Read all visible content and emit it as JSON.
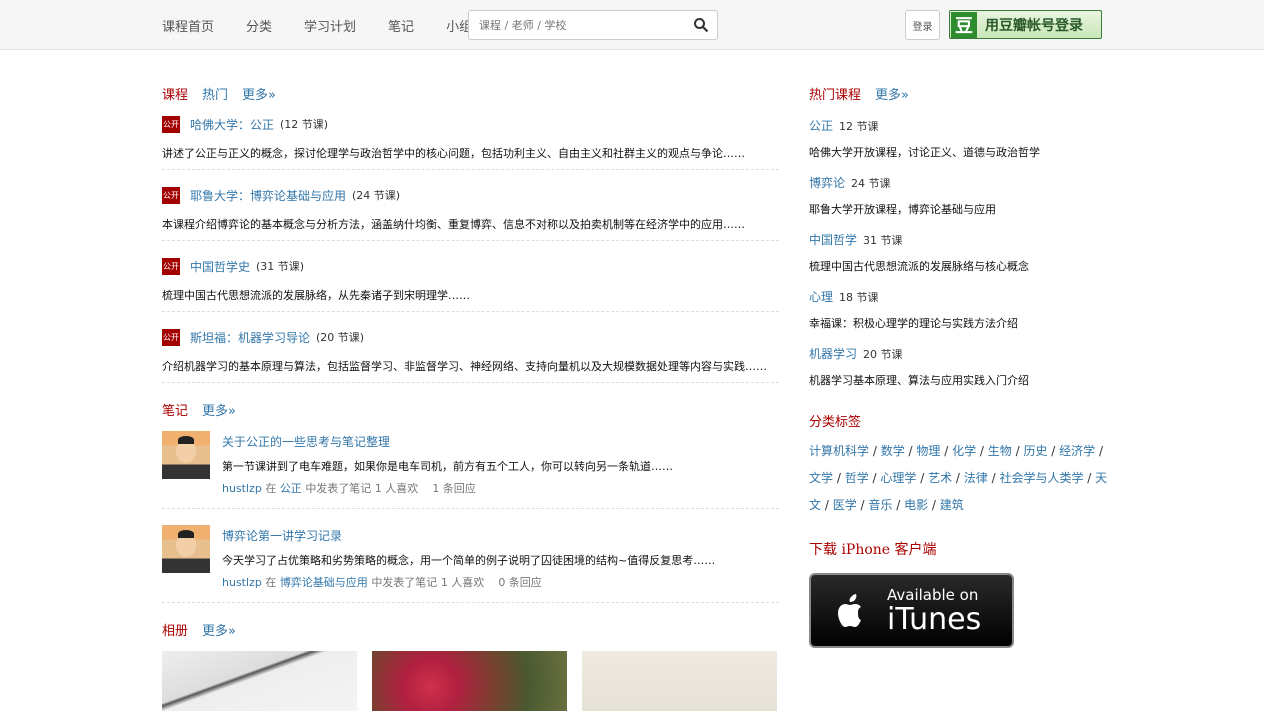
{
  "nav": [
    "课程首页",
    "分类",
    "学习计划",
    "笔记",
    "小组"
  ],
  "search": {
    "placeholder": "课程 / 老师 / 学校"
  },
  "header": {
    "lang_label": "登录",
    "login_logo": "豆",
    "login_label": "用豆瓣帐号登录"
  },
  "lessons_section": {
    "title": "课程",
    "sub": "热门",
    "more": "更多»"
  },
  "lessons": [
    {
      "badge": "公开",
      "title": "哈佛大学：公正",
      "meta": "(12 节课)",
      "desc": "讲述了公正与正义的概念，探讨伦理学与政治哲学中的核心问题，包括功利主义、自由主义和社群主义的观点与争论……"
    },
    {
      "badge": "公开",
      "title": "耶鲁大学：博弈论基础与应用",
      "meta": "(24 节课)",
      "desc": "本课程介绍博弈论的基本概念与分析方法，涵盖纳什均衡、重复博弈、信息不对称以及拍卖机制等在经济学中的应用……"
    },
    {
      "badge": "公开",
      "title": "中国哲学史",
      "meta": "(31 节课)",
      "desc": "梳理中国古代思想流派的发展脉络，从先秦诸子到宋明理学……"
    },
    {
      "badge": "公开",
      "title": "斯坦福：机器学习导论",
      "meta": "(20 节课)",
      "desc": "介绍机器学习的基本原理与算法，包括监督学习、非监督学习、神经网络、支持向量机以及大规模数据处理等内容与实践……"
    }
  ],
  "notes_section": {
    "title": "笔记",
    "more": "更多»"
  },
  "notes": [
    {
      "title": "关于公正的一些思考与笔记整理",
      "excerpt": "第一节课讲到了电车难题，如果你是电车司机，前方有五个工人，你可以转向另一条轨道……",
      "user": "hustlzp",
      "in": "在",
      "course": "公正",
      "tail": "中发表了笔记",
      "likes": "1 人喜欢",
      "comments": "1 条回应"
    },
    {
      "title": "博弈论第一讲学习记录",
      "excerpt": "今天学习了占优策略和劣势策略的概念，用一个简单的例子说明了囚徒困境的结构~值得反复思考……",
      "user": "hustlzp",
      "in": "在",
      "course": "博弈论基础与应用",
      "tail": "中发表了笔记",
      "likes": "1 人喜欢",
      "comments": "0 条回应"
    }
  ],
  "photos_section": {
    "title": "相册",
    "more": "更多»"
  },
  "side": {
    "courses_title": "热门课程",
    "courses_more": "更多»",
    "courses": [
      {
        "name": "公正",
        "count": "12 节课",
        "desc": "哈佛大学开放课程，讨论正义、道德与政治哲学"
      },
      {
        "name": "博弈论",
        "count": "24 节课",
        "desc": "耶鲁大学开放课程，博弈论基础与应用"
      },
      {
        "name": "中国哲学",
        "count": "31 节课",
        "desc": "梳理中国古代思想流派的发展脉络与核心概念"
      },
      {
        "name": "心理",
        "count": "18 节课",
        "desc": "幸福课：积极心理学的理论与实践方法介绍"
      },
      {
        "name": "机器学习",
        "count": "20 节课",
        "desc": "机器学习基本原理、算法与应用实践入门介绍"
      }
    ],
    "tags_title": "分类标签",
    "tags": [
      "计算机科学",
      "数学",
      "物理",
      "化学",
      "生物",
      "历史",
      "经济学",
      "文学",
      "哲学",
      "心理学",
      "艺术",
      "法律",
      "社会学与人类学",
      "天文",
      "医学",
      "音乐",
      "电影",
      "建筑"
    ],
    "iphone": "下载 iPhone 客户端",
    "itunes_small": "Available on",
    "itunes_big": "iTunes"
  }
}
